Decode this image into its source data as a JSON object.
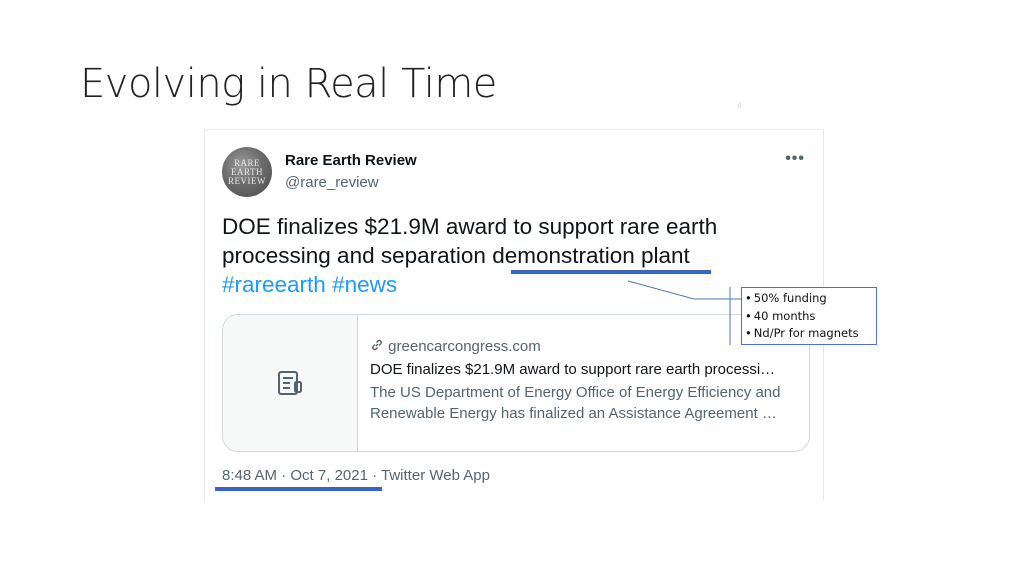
{
  "slide": {
    "title": "Evolving in Real Time"
  },
  "tweet": {
    "author_name": "Rare Earth Review",
    "author_handle": "@rare_review",
    "avatar_text": [
      "RARE",
      "EARTH",
      "REVIEW"
    ],
    "more_icon": "more-horizontal-icon",
    "text": {
      "line1": "DOE finalizes $21.9M award to support rare earth",
      "line2_prefix": "processing and separation ",
      "line2_highlight": "demonstration plant",
      "hashtag1": "#rareearth",
      "hashtag2": "#news"
    },
    "card": {
      "thumb_icon": "article-icon",
      "link_icon": "link-icon",
      "domain": "greencarcongress.com",
      "title": "DOE finalizes $21.9M award to support rare earth processi…",
      "description_line1": "The US Department of Energy Office of Energy Efficiency and",
      "description_line2": "Renewable Energy has finalized an Assistance Agreement …"
    },
    "meta": {
      "time": "8:48 AM",
      "sep1": " · ",
      "date": "Oct 7, 2021",
      "sep2": " · ",
      "source": "Twitter Web App"
    }
  },
  "callout": {
    "items": [
      "50% funding",
      "40 months",
      "Nd/Pr for magnets"
    ],
    "border_color": "#4f71b8"
  },
  "colors": {
    "underline": "#3a64c2",
    "hashtag": "#1d9bf0",
    "secondary_text": "#536471"
  }
}
